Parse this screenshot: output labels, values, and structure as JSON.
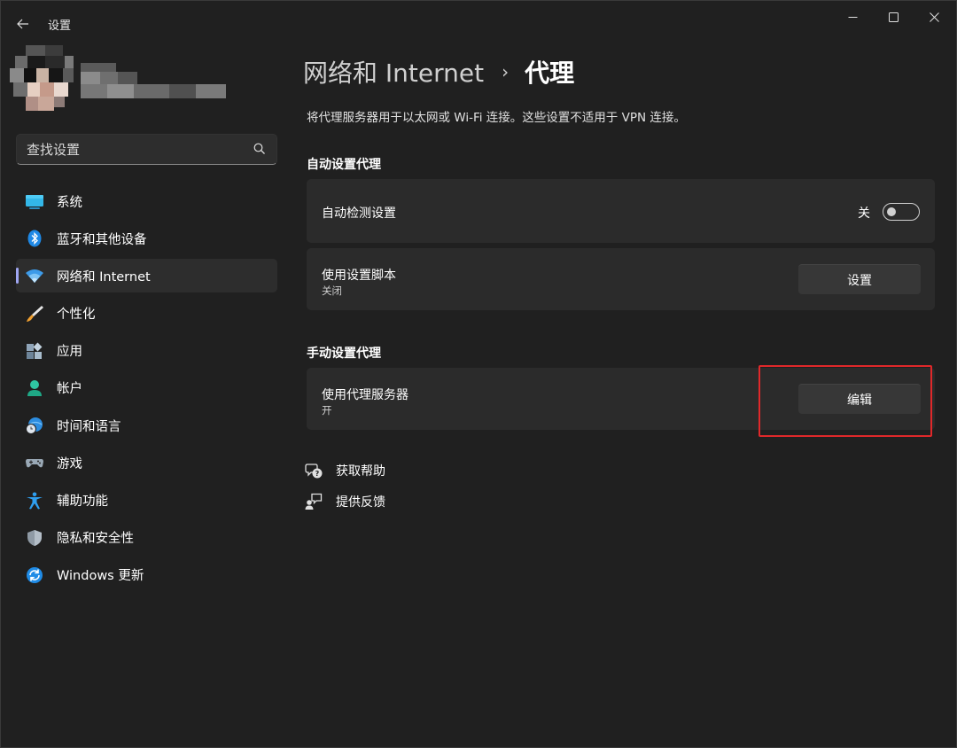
{
  "window": {
    "title": "设置"
  },
  "search": {
    "placeholder": "查找设置"
  },
  "sidebar": {
    "items": [
      {
        "label": "系统",
        "icon": "monitor-icon"
      },
      {
        "label": "蓝牙和其他设备",
        "icon": "bluetooth-icon"
      },
      {
        "label": "网络和 Internet",
        "icon": "wifi-icon",
        "active": true
      },
      {
        "label": "个性化",
        "icon": "paintbrush-icon"
      },
      {
        "label": "应用",
        "icon": "apps-icon"
      },
      {
        "label": "帐户",
        "icon": "account-icon"
      },
      {
        "label": "时间和语言",
        "icon": "time-language-icon"
      },
      {
        "label": "游戏",
        "icon": "gamepad-icon"
      },
      {
        "label": "辅助功能",
        "icon": "accessibility-icon"
      },
      {
        "label": "隐私和安全性",
        "icon": "shield-icon"
      },
      {
        "label": "Windows 更新",
        "icon": "windows-update-icon"
      }
    ]
  },
  "header": {
    "parent": "网络和 Internet",
    "separator": "›",
    "current": "代理"
  },
  "description": "将代理服务器用于以太网或 Wi-Fi 连接。这些设置不适用于 VPN 连接。",
  "auto_proxy": {
    "section_title": "自动设置代理",
    "detect": {
      "title": "自动检测设置",
      "toggle_label": "关",
      "toggle_on": false
    },
    "script": {
      "title": "使用设置脚本",
      "status": "关闭",
      "button_label": "设置"
    }
  },
  "manual_proxy": {
    "section_title": "手动设置代理",
    "server": {
      "title": "使用代理服务器",
      "status": "开",
      "button_label": "编辑"
    }
  },
  "help": {
    "get_help": "获取帮助",
    "feedback": "提供反馈"
  },
  "colors": {
    "background": "#202020",
    "card": "#2b2b2b",
    "accent": "#9fa6f2",
    "highlight": "#e0282a"
  }
}
